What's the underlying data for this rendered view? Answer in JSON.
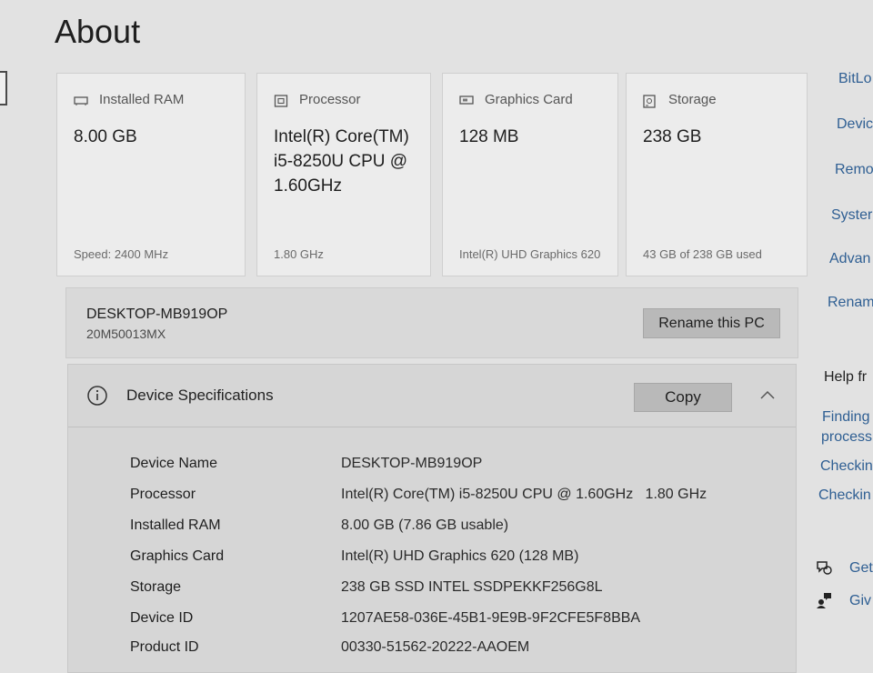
{
  "page": {
    "title": "About"
  },
  "cards": [
    {
      "label": "Installed RAM",
      "icon": "ram-icon",
      "value": "8.00 GB",
      "sub": "Speed: 2400 MHz"
    },
    {
      "label": "Processor",
      "icon": "processor-icon",
      "value": "Intel(R) Core(TM) i5-8250U CPU @ 1.60GHz",
      "sub": "1.80 GHz"
    },
    {
      "label": "Graphics Card",
      "icon": "graphics-card-icon",
      "value": "128 MB",
      "sub": "Intel(R) UHD Graphics 620"
    },
    {
      "label": "Storage",
      "icon": "storage-icon",
      "value": "238 GB",
      "sub": "43 GB of 238 GB used"
    }
  ],
  "device": {
    "name": "DESKTOP-MB919OP",
    "model": "20M50013MX",
    "rename_label": "Rename this PC"
  },
  "specs": {
    "title": "Device Specifications",
    "copy_label": "Copy",
    "rows": [
      {
        "key": "Device Name",
        "value": "DESKTOP-MB919OP"
      },
      {
        "key": "Processor",
        "value": "Intel(R) Core(TM) i5-8250U CPU @ 1.60GHz   1.80 GHz"
      },
      {
        "key": "Installed RAM",
        "value": "8.00 GB (7.86 GB usable)"
      },
      {
        "key": "Graphics Card",
        "value": "Intel(R) UHD Graphics 620 (128 MB)"
      },
      {
        "key": "Storage",
        "value": "238 GB SSD INTEL SSDPEKKF256G8L"
      },
      {
        "key": "Device ID",
        "value": "1207AE58-036E-45B1-9E9B-9F2CFE5F8BBA"
      },
      {
        "key": "Product ID",
        "value": "00330-51562-20222-AAOEM"
      }
    ]
  },
  "related_links": [
    "BitLo",
    "Devic",
    "Remo",
    "Syster",
    "Advan",
    "Renam"
  ],
  "help": {
    "heading": "Help fr",
    "links": [
      "Finding",
      "process",
      "Checkin",
      "Checkin"
    ]
  },
  "footer_links": [
    {
      "icon": "get-help-icon",
      "label": "Get"
    },
    {
      "icon": "give-feedback-icon",
      "label": "Giv"
    }
  ],
  "colors": {
    "link": "#2f5f93",
    "background": "#e2e2e2",
    "card": "#ececec"
  }
}
